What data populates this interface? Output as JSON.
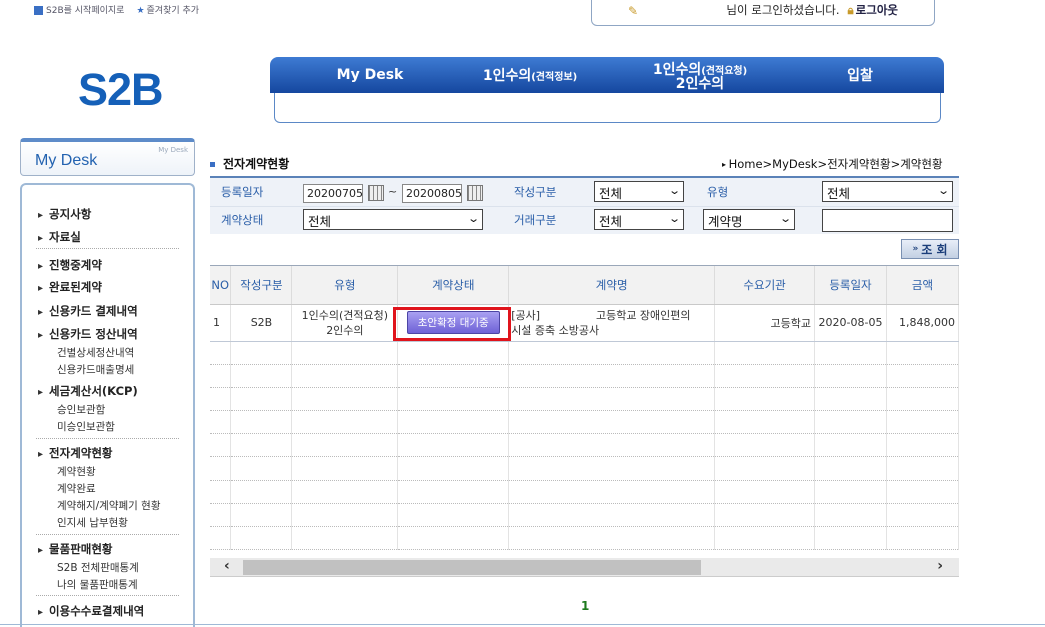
{
  "top": {
    "start_page_label": "S2B를 시작페이지로",
    "favorite_label": "즐겨찾기 추가",
    "login_message": "님이 로그인하셨습니다.",
    "logout_label": "로그아웃"
  },
  "logo": "S2B",
  "nav": [
    {
      "label": "My Desk"
    },
    {
      "label": "1인수의",
      "small": "(견적정보)"
    },
    {
      "label": "1인수의",
      "small": "(견적요청)",
      "line2": "2인수의"
    },
    {
      "label": "입찰"
    }
  ],
  "sidebar": {
    "tab_title": "My Desk",
    "tab_small": "My Desk",
    "items": [
      {
        "label": "공지사항"
      },
      {
        "label": "자료실"
      },
      {
        "label": "진행중계약"
      },
      {
        "label": "완료된계약"
      },
      {
        "label": "신용카드 결제내역"
      },
      {
        "label": "신용카드 정산내역"
      },
      {
        "label": "건별상세정산내역"
      },
      {
        "label": "신용카드매출명세"
      },
      {
        "label": "세금계산서(KCP)"
      },
      {
        "label": "승인보관함"
      },
      {
        "label": "미승인보관함"
      },
      {
        "label": "전자계약현황"
      },
      {
        "label": "계약현황"
      },
      {
        "label": "계약완료"
      },
      {
        "label": "계약해지/계약폐기 현황"
      },
      {
        "label": "인지세 납부현황"
      },
      {
        "label": "물품판매현황"
      },
      {
        "label": "S2B 전체판매통계"
      },
      {
        "label": "나의 물품판매통계"
      },
      {
        "label": "이용수수료결제내역"
      }
    ]
  },
  "page": {
    "title": "전자계약현황",
    "breadcrumb": "Home>MyDesk>전자계약현황>계약현황"
  },
  "filter": {
    "reg_date_label": "등록일자",
    "date_from": "20200705",
    "tilde": "~",
    "date_to": "20200805",
    "write_type_label": "작성구분",
    "write_type_value": "전체",
    "type_label": "유형",
    "type_value": "전체",
    "contract_status_label": "계약상태",
    "contract_status_value": "전체",
    "trade_type_label": "거래구분",
    "trade_type_value": "전체",
    "search_field_value": "계약명",
    "search_text": "",
    "search_button": "조 회"
  },
  "table": {
    "headers": [
      "NO",
      "작성구분",
      "유형",
      "계약상태",
      "계약명",
      "수요기관",
      "등록일자",
      "금액"
    ],
    "rows": [
      {
        "no": "1",
        "write_type": "S2B",
        "type_line1": "1인수의(견적요청)",
        "type_line2": "2인수의",
        "status": "초안확정 대기중",
        "name_line1": "[공사]                고등학교 장애인편의",
        "name_line2": "시설 증축 소방공사",
        "agency": "고등학교",
        "reg_date": "2020-08-05",
        "amount": "1,848,000"
      }
    ]
  },
  "pager": {
    "current": "1"
  }
}
